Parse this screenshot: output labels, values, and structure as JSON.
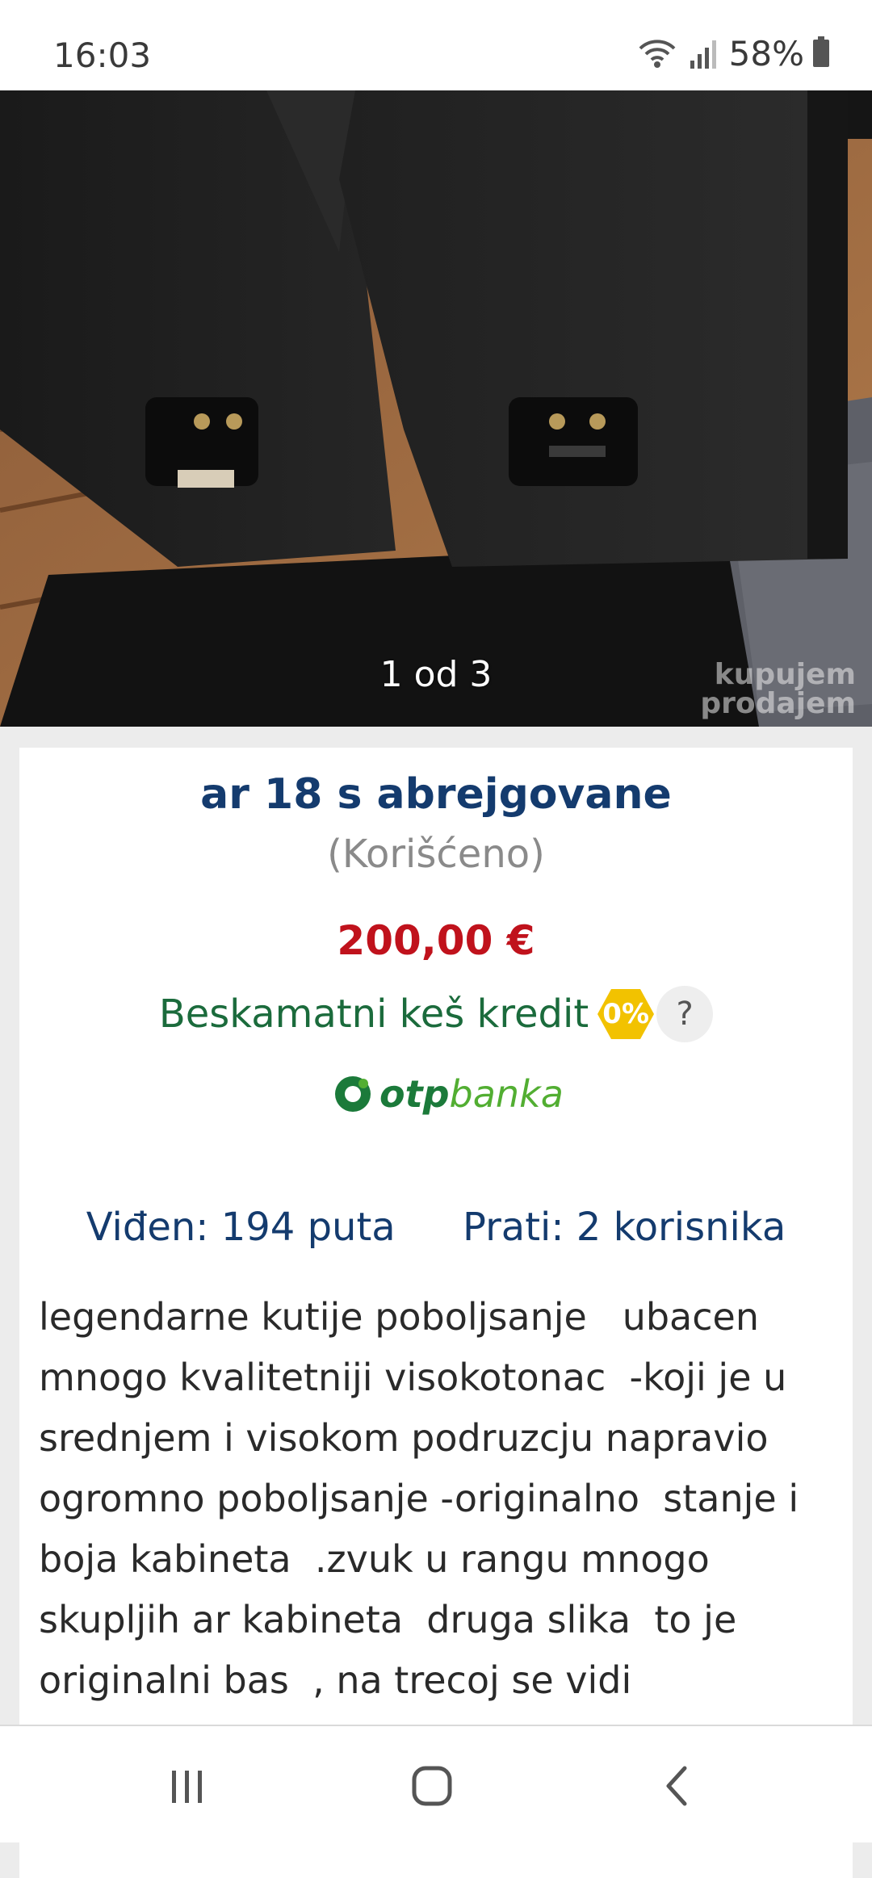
{
  "status_bar": {
    "time": "16:03",
    "battery": "58%",
    "icons": [
      "wifi-icon",
      "signal-icon",
      "battery-icon"
    ]
  },
  "photo": {
    "counter": "1 od 3",
    "watermark_line1": "kupujem",
    "watermark_line2": "prodajem"
  },
  "listing": {
    "title": "ar 18 s abrejgovane",
    "condition": "(Korišćeno)",
    "price": "200,00 €",
    "credit_label": "Beskamatni keš kredit",
    "credit_badge": "0%",
    "help": "?",
    "bank_logo": "otpbanka",
    "views": "Viđen: 194 puta",
    "followers": "Prati: 2 korisnika",
    "description": "legendarne kutije poboljsanje   ubacen\nmnogo kvalitetniji visokotonac  -koji je u\nsrednjem i visokom podruzcju napravio\nogromno poboljsanje -originalno  stanje i\nboja kabineta  .zvuk u rangu mnogo\nskupljih ar kabineta  druga slika  to je\noriginalni bas  , na trecoj se vidi"
  },
  "colors": {
    "title": "#143b6e",
    "price": "#c0121c",
    "credit": "#1b6b3c",
    "badge": "#f2c200"
  },
  "nav": {
    "icons": [
      "recent-apps-icon",
      "home-icon",
      "back-icon"
    ]
  }
}
